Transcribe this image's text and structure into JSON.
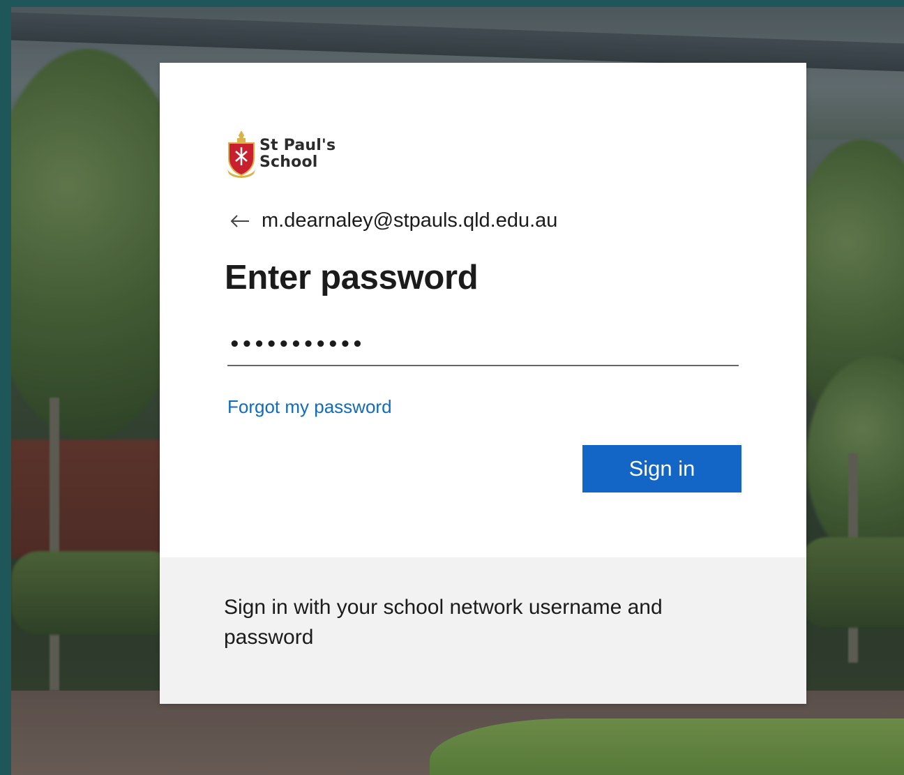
{
  "org": {
    "name_line1": "St Paul's",
    "name_line2": "School",
    "crest_icon": "school-crest-icon",
    "crest_colors": {
      "shield": "#c8202f",
      "gold": "#d9b24a"
    }
  },
  "identity": {
    "back_icon": "arrow-left-icon",
    "email": "m.dearnaley@stpauls.qld.edu.au"
  },
  "form": {
    "title": "Enter password",
    "password_value": "•••••••••••",
    "forgot_label": "Forgot my password",
    "signin_label": "Sign in"
  },
  "footer": {
    "text": "Sign in with your school network username and password"
  },
  "colors": {
    "accent": "#1366c5",
    "link": "#0f6cbd",
    "footer_bg": "#f2f2f2"
  }
}
